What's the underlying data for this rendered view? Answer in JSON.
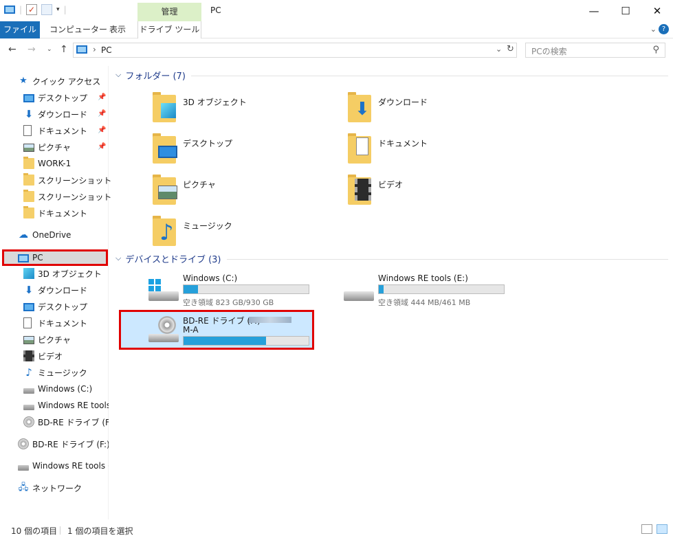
{
  "window": {
    "title": "PC",
    "contextual_tab_group": "管理",
    "controls": {
      "minimize": "—",
      "maximize": "☐",
      "close": "✕"
    }
  },
  "ribbon": {
    "tabs": [
      "ファイル",
      "コンピューター",
      "表示",
      "ドライブ ツール"
    ]
  },
  "address": {
    "path": "PC",
    "search_placeholder": "PCの検索"
  },
  "sidebar": {
    "quick_access": "クイック アクセス",
    "quick_items": [
      {
        "label": "デスクトップ",
        "icon": "desktop-icon",
        "pinned": true
      },
      {
        "label": "ダウンロード",
        "icon": "download-icon",
        "pinned": true
      },
      {
        "label": "ドキュメント",
        "icon": "document-icon",
        "pinned": true
      },
      {
        "label": "ピクチャ",
        "icon": "picture-icon",
        "pinned": true
      },
      {
        "label": "WORK-1",
        "icon": "folder-icon",
        "pinned": false
      },
      {
        "label": "スクリーンショット",
        "icon": "folder-icon",
        "pinned": false
      },
      {
        "label": "スクリーンショット",
        "icon": "folder-icon",
        "pinned": false
      },
      {
        "label": "ドキュメント",
        "icon": "folder-icon",
        "pinned": false
      }
    ],
    "onedrive": "OneDrive",
    "pc": "PC",
    "pc_items": [
      {
        "label": "3D オブジェクト",
        "icon": "3d-objects-icon"
      },
      {
        "label": "ダウンロード",
        "icon": "download-icon"
      },
      {
        "label": "デスクトップ",
        "icon": "desktop-icon"
      },
      {
        "label": "ドキュメント",
        "icon": "document-icon"
      },
      {
        "label": "ピクチャ",
        "icon": "picture-icon"
      },
      {
        "label": "ビデオ",
        "icon": "video-icon"
      },
      {
        "label": "ミュージック",
        "icon": "music-icon"
      },
      {
        "label": "Windows (C:)",
        "icon": "drive-icon"
      },
      {
        "label": "Windows RE tools (E:)",
        "icon": "drive-icon"
      },
      {
        "label": "BD-RE ドライブ (F:) De",
        "icon": "disc-drive-icon"
      }
    ],
    "bd_drive": "BD-RE ドライブ (F:) Deb",
    "re_tools": "Windows RE tools (E:",
    "network": "ネットワーク"
  },
  "main": {
    "folders_group": "フォルダー (7)",
    "folders": [
      {
        "label": "3D オブジェクト",
        "icon": "3d-objects-icon"
      },
      {
        "label": "ダウンロード",
        "icon": "download-icon"
      },
      {
        "label": "デスクトップ",
        "icon": "desktop-icon"
      },
      {
        "label": "ドキュメント",
        "icon": "document-icon"
      },
      {
        "label": "ピクチャ",
        "icon": "picture-icon"
      },
      {
        "label": "ビデオ",
        "icon": "video-icon"
      },
      {
        "label": "ミュージック",
        "icon": "music-icon"
      }
    ],
    "devices_group": "デバイスとドライブ (3)",
    "drives": [
      {
        "name": "Windows (C:)",
        "free_text": "空き領域 823 GB/930 GB",
        "used_fraction": 0.115,
        "icon": "windows-drive-icon"
      },
      {
        "name": "Windows RE tools (E:)",
        "free_text": "空き領域 444 MB/461 MB",
        "used_fraction": 0.037,
        "icon": "drive-icon"
      },
      {
        "name": "BD-RE ドライブ (F:)",
        "name_line2": "M-A",
        "used_fraction": 0.66,
        "icon": "disc-drive-icon"
      }
    ]
  },
  "status": {
    "item_count": "10 個の項目",
    "selected": "1 個の項目を選択"
  },
  "colors": {
    "accent": "#1a6fb9",
    "selection": "#cce8ff",
    "highlight_box": "#e00000",
    "bar_fill": "#26a0da",
    "manage_tab": "#dcf0c8"
  }
}
